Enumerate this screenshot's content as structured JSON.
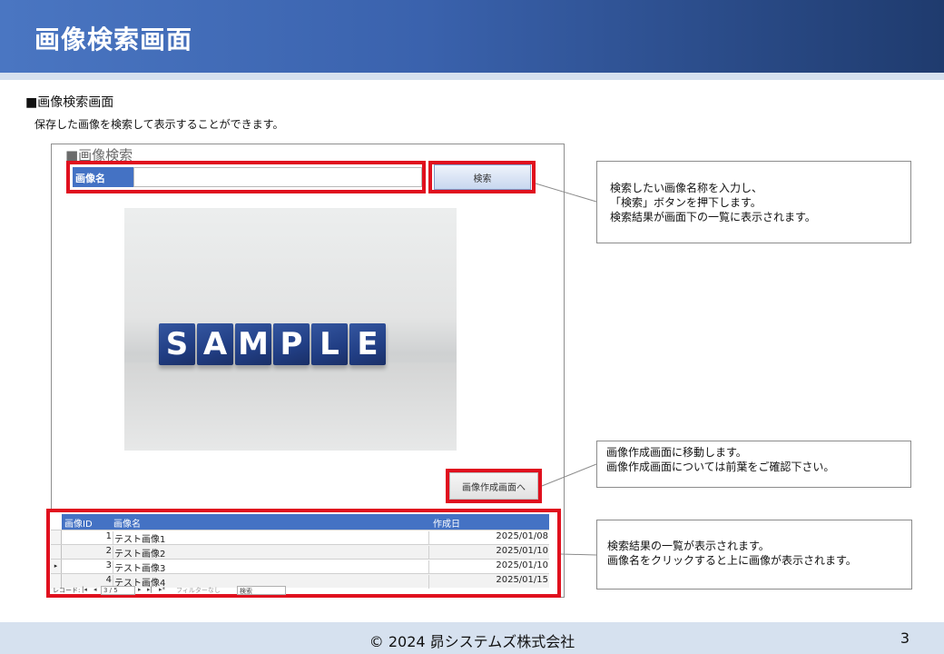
{
  "header": {
    "title": "画像検索画面"
  },
  "intro": {
    "section_title": "■画像検索画面",
    "description": "保存した画像を検索して表示することができます。"
  },
  "form": {
    "heading": "■画像検索",
    "search_label": "画像名",
    "search_value": "",
    "search_button": "検索",
    "image_text": "SAMPLE",
    "image_letters": [
      "S",
      "A",
      "M",
      "P",
      "L",
      "E"
    ],
    "nav_button": "画像作成画面へ"
  },
  "grid": {
    "headers": {
      "id": "画像ID",
      "name": "画像名",
      "date": "作成日"
    },
    "rows": [
      {
        "id": "1",
        "name": "テスト画像1",
        "date": "2025/01/08"
      },
      {
        "id": "2",
        "name": "テスト画像2",
        "date": "2025/01/10"
      },
      {
        "id": "3",
        "name": "テスト画像3",
        "date": "2025/01/10"
      },
      {
        "id": "4",
        "name": "テスト画像4",
        "date": "2025/01/15"
      }
    ],
    "current_row_marker": "▸",
    "record_label": "レコード:",
    "first": "|◂",
    "prev": "◂",
    "position": "3 / 5",
    "next": "▸",
    "last": "▸|",
    "new": "▸*",
    "filter": "フィルターなし",
    "search": "検索"
  },
  "callouts": {
    "search": [
      "検索したい画像名称を入力し、",
      "「検索」ボタンを押下します。",
      "検索結果が画面下の一覧に表示されます。"
    ],
    "nav": [
      "画像作成画面に移動します。",
      "画像作成画面については前葉をご確認下さい。"
    ],
    "list": [
      "検索結果の一覧が表示されます。",
      "画像名をクリックすると上に画像が表示されます。"
    ]
  },
  "footer": {
    "copyright": "© 2024 昴システムズ株式会社",
    "page_number": "3"
  },
  "colors": {
    "header_dark": "#1f3b6e",
    "header_light": "#4a76c2",
    "highlight_red": "#e0101e",
    "grid_header": "#4472c4",
    "footer_band": "#d6e1ef"
  }
}
